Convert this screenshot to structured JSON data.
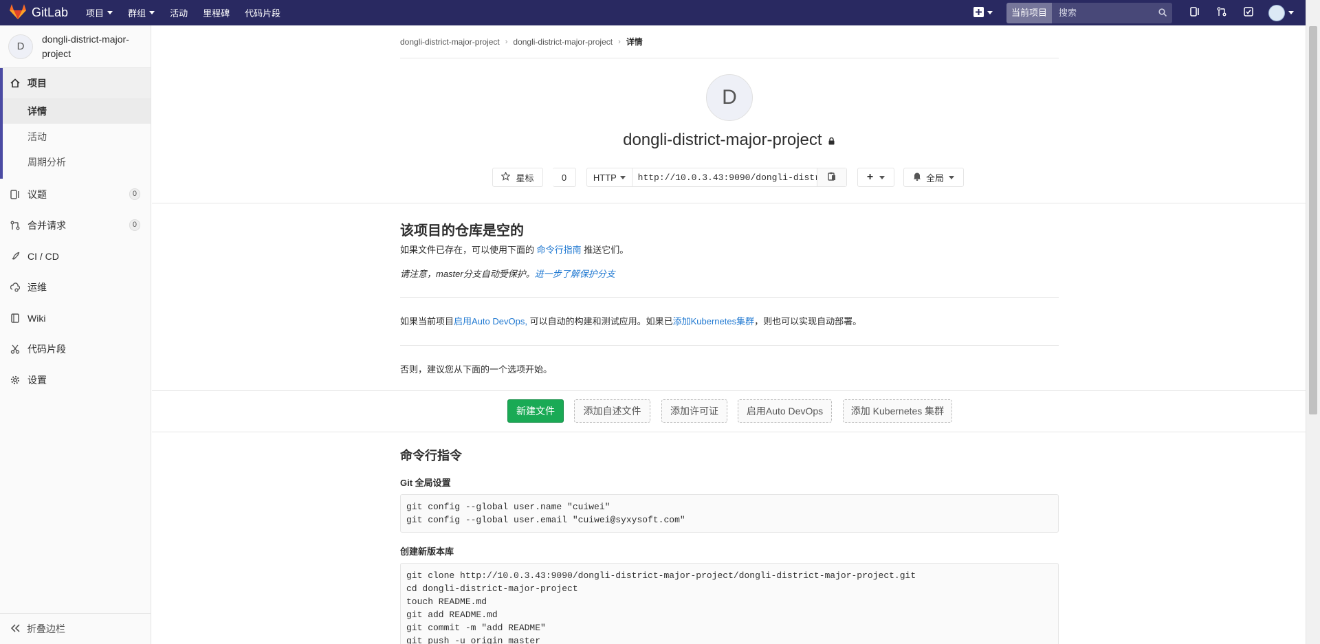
{
  "navbar": {
    "brand": "GitLab",
    "links": [
      {
        "label": "项目",
        "caret": true
      },
      {
        "label": "群组",
        "caret": true
      },
      {
        "label": "活动",
        "caret": false
      },
      {
        "label": "里程碑",
        "caret": false
      },
      {
        "label": "代码片段",
        "caret": false
      }
    ],
    "search_scope": "当前项目",
    "search_placeholder": "搜索"
  },
  "sidebar": {
    "project_initial": "D",
    "project_name": "dongli-district-major-project",
    "section_project": "项目",
    "sub_items": [
      "详情",
      "活动",
      "周期分析"
    ],
    "issues": "议题",
    "issues_count": "0",
    "merge_requests": "合并请求",
    "merge_requests_count": "0",
    "cicd": "CI / CD",
    "operations": "运维",
    "wiki": "Wiki",
    "snippets": "代码片段",
    "settings": "设置",
    "collapse": "折叠边栏"
  },
  "breadcrumb": {
    "group": "dongli-district-major-project",
    "project": "dongli-district-major-project",
    "current": "详情"
  },
  "project": {
    "initial": "D",
    "title": "dongli-district-major-project",
    "star_label": "星标",
    "star_count": "0",
    "protocol": "HTTP",
    "clone_url": "http://10.0.3.43:9090/dongli-district-major-project/dongli-district-major-project.git",
    "notification": "全局"
  },
  "empty_repo": {
    "title": "该项目的仓库是空的",
    "line1_prefix": "如果文件已存在，可以使用下面的 ",
    "line1_link": "命令行指南",
    "line1_suffix": " 推送它们。",
    "line2_prefix": "请注意，master分支自动受保护。",
    "line2_link": "进一步了解保护分支",
    "devops_prefix": "如果当前项目",
    "devops_link": "启用Auto DevOps,",
    "devops_middle": " 可以自动的构建和测试应用。如果已",
    "k8s_link": "添加Kubernetes集群",
    "devops_suffix": "，则也可以实现自动部署。",
    "otherwise": "否则，建议您从下面的一个选项开始。"
  },
  "buttons": {
    "new_file": "新建文件",
    "add_readme": "添加自述文件",
    "add_license": "添加许可证",
    "enable_devops": "启用Auto DevOps",
    "add_k8s": "添加 Kubernetes 集群"
  },
  "commands": {
    "title": "命令行指令",
    "git_global_title": "Git 全局设置",
    "git_global_code": "git config --global user.name \"cuiwei\"\ngit config --global user.email \"cuiwei@syxysoft.com\"",
    "new_repo_title": "创建新版本库",
    "new_repo_code": "git clone http://10.0.3.43:9090/dongli-district-major-project/dongli-district-major-project.git\ncd dongli-district-major-project\ntouch README.md\ngit add README.md\ngit commit -m \"add README\"\ngit push -u origin master"
  },
  "colors": {
    "navbar": "#292961",
    "accent": "#4b4ba3",
    "primary_button": "#1aaa55",
    "link": "#1f78d1"
  }
}
